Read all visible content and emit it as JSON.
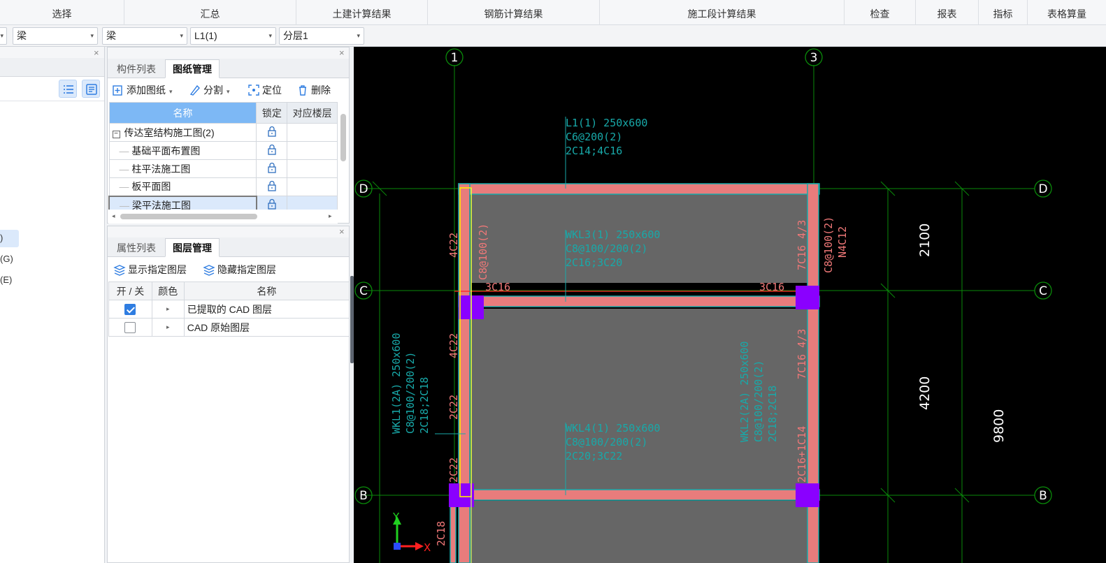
{
  "ribbon": {
    "groups": [
      "选择",
      "汇总",
      "土建计算结果",
      "钢筋计算结果",
      "施工段计算结果",
      "检查",
      "报表",
      "指标",
      "表格算量"
    ]
  },
  "selectors": {
    "floor": "梁",
    "type": "梁",
    "component": "L1(1)",
    "layer": "分层1"
  },
  "left_strip": {
    "items": [
      ")",
      "(G)",
      "(E)"
    ]
  },
  "drawing_panel": {
    "tabs": [
      "构件列表",
      "图纸管理"
    ],
    "active_tab": "图纸管理",
    "toolbar": {
      "add": "添加图纸",
      "split": "分割",
      "locate": "定位",
      "delete": "删除"
    },
    "columns": [
      "名称",
      "锁定",
      "对应楼层"
    ],
    "root": "传达室结构施工图(2)",
    "rows": [
      "基础平面布置图",
      "柱平法施工图",
      "板平面图",
      "梁平法施工图"
    ],
    "selected_row": "梁平法施工图"
  },
  "layer_panel": {
    "tabs": [
      "属性列表",
      "图层管理"
    ],
    "active_tab": "图层管理",
    "show_btn": "显示指定图层",
    "hide_btn": "隐藏指定图层",
    "columns": [
      "开 / 关",
      "颜色",
      "名称"
    ],
    "rows": [
      {
        "name": "已提取的 CAD 图层",
        "on": true
      },
      {
        "name": "CAD 原始图层",
        "on": false
      }
    ]
  },
  "cad": {
    "axis_top": [
      "1",
      "3"
    ],
    "axis_rows": [
      "D",
      "C",
      "B"
    ],
    "dims": [
      "2100",
      "4200",
      "9800"
    ],
    "beam_L1": [
      "L1(1) 250x600",
      "C6@200(2)",
      "2C14;4C16"
    ],
    "beam_WKL3": [
      "WKL3(1) 250x600",
      "C8@100/200(2)",
      "2C16;3C20"
    ],
    "beam_WKL4": [
      "WKL4(1) 250x600",
      "C8@100/200(2)",
      "2C20;3C22"
    ],
    "beam_WKL1": [
      "WKL1(2A) 250x600",
      "C8@100/200(2)",
      "2C18;2C18"
    ],
    "beam_WKL2": [
      "WKL2(2A) 250x600",
      "C8@100/200(2)",
      "2C18;2C18"
    ],
    "red_labels": {
      "a": "4C22",
      "b": "C8@100(2)",
      "c": "3C16",
      "d": "3C16",
      "e": "7C16 4/3",
      "f": "C8@100(2)",
      "g": "N4C12",
      "h": "4C22",
      "i": "2C22",
      "j": "2C22",
      "k": "7C16 4/3",
      "l": "2C16+1C14",
      "m": "2C18"
    },
    "ucs": {
      "x": "X",
      "y": "Y"
    },
    "colors": {
      "beam": "#e87c7c",
      "column": "#8a00ff",
      "grid": "#0a8a0a",
      "anno": "#18a9a9",
      "slab": "#666666"
    }
  }
}
